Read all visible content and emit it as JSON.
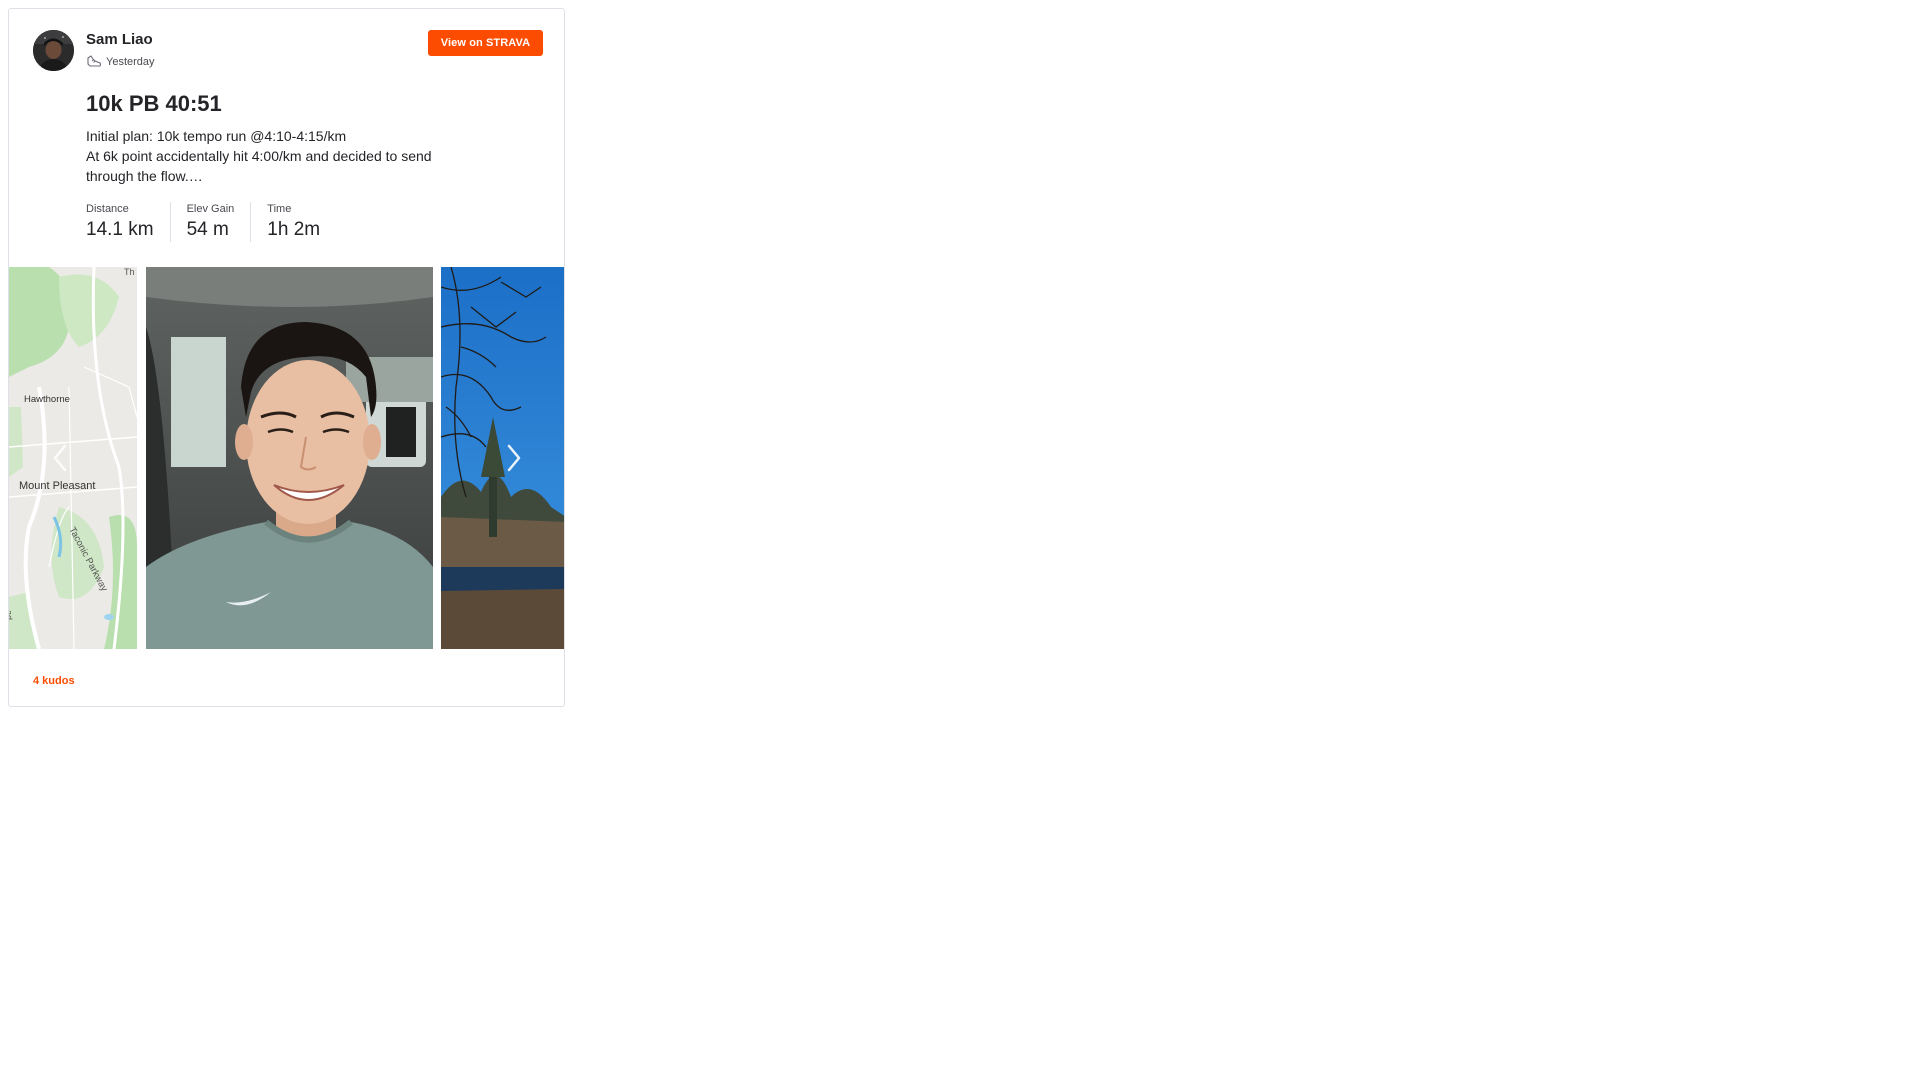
{
  "athlete": {
    "name": "Sam Liao",
    "when": "Yesterday",
    "activity_type_icon": "shoe-icon"
  },
  "header": {
    "view_button_label": "View on STRAVA",
    "brand_color": "#fc4c02"
  },
  "activity": {
    "title": "10k PB 40:51",
    "description_lines": [
      "Initial plan: 10k tempo run @4:10-4:15/km",
      "At 6k point accidentally hit 4:00/km and decided to send",
      "through the flow.…"
    ],
    "stats": [
      {
        "label": "Distance",
        "value": "14.1 km"
      },
      {
        "label": "Elev Gain",
        "value": "54 m"
      },
      {
        "label": "Time",
        "value": "1h 2m"
      }
    ]
  },
  "media": {
    "map_labels": {
      "town1": "Hawthorne",
      "town2": "Mount Pleasant",
      "road": "Taconic Parkway",
      "edge_top": "Th",
      "edge_left": "ad"
    }
  },
  "footer": {
    "kudos_label": "4 kudos"
  }
}
